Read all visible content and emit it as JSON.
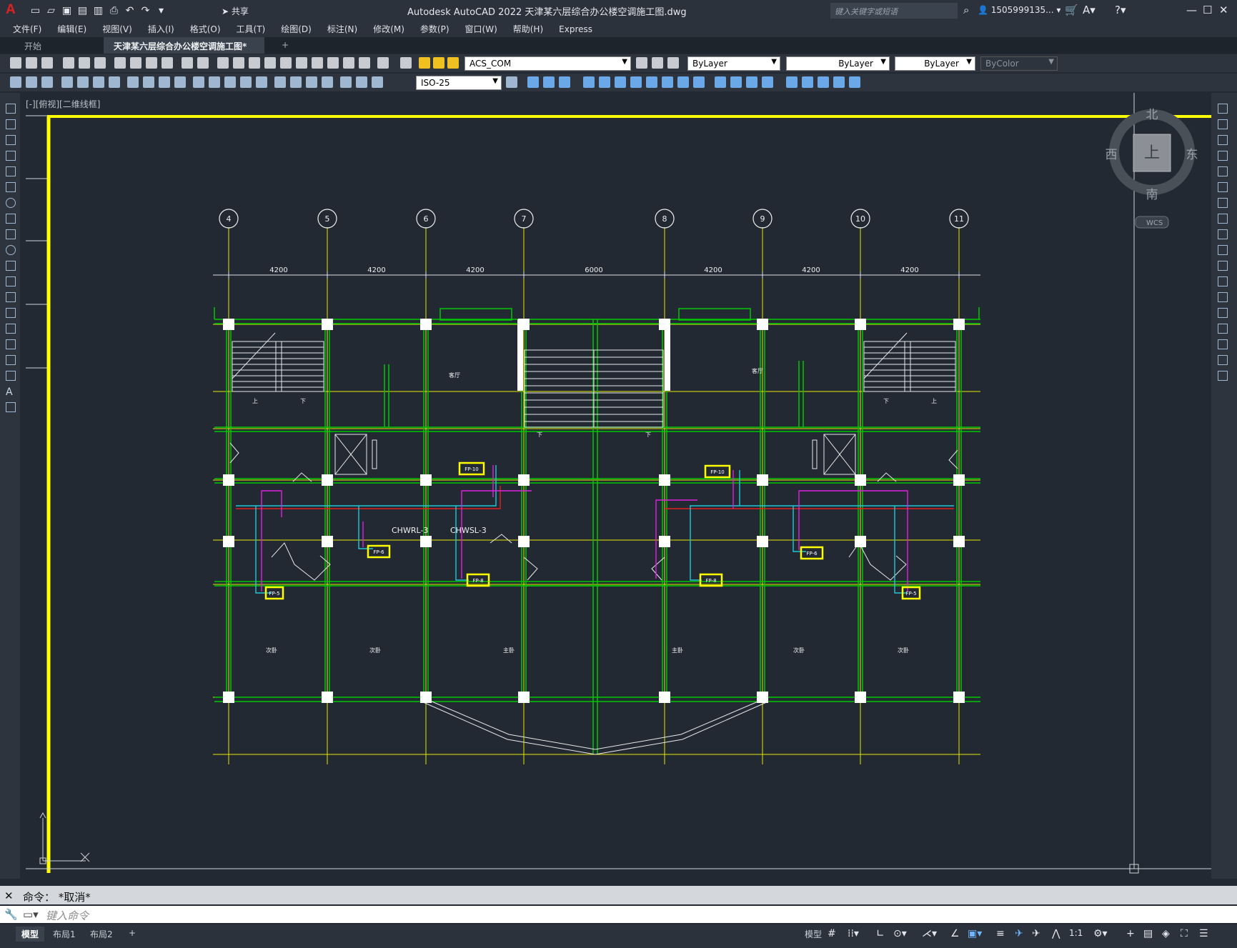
{
  "app": {
    "logo": "A",
    "title": "Autodesk AutoCAD 2022    天津某六层综合办公楼空调施工图.dwg",
    "share_label": "共享",
    "search_placeholder": "键入关键字或短语",
    "user": "1505999135..."
  },
  "menu": [
    "文件(F)",
    "编辑(E)",
    "视图(V)",
    "插入(I)",
    "格式(O)",
    "工具(T)",
    "绘图(D)",
    "标注(N)",
    "修改(M)",
    "参数(P)",
    "窗口(W)",
    "帮助(H)",
    "Express"
  ],
  "tabs": {
    "start": "开始",
    "active": "天津某六层综合办公楼空调施工图*"
  },
  "toolbar": {
    "layer": "ACS_COM",
    "color": "ByLayer",
    "linetype": "ByLayer",
    "lineweight": "ByLayer",
    "plotstyle": "ByColor",
    "dimstyle": "ISO-25"
  },
  "viewport": {
    "label": "[-][俯视][二维线框]",
    "compass": {
      "north": "北",
      "south": "南",
      "east": "东",
      "west": "西",
      "top": "上"
    },
    "wcs": "WCS"
  },
  "drawing": {
    "grid_labels": [
      "4",
      "5",
      "6",
      "7",
      "8",
      "9",
      "10",
      "11"
    ],
    "dims": [
      "4200",
      "4200",
      "4200",
      "6000",
      "4200",
      "4200",
      "4200"
    ],
    "pipes": [
      "CHWRL-3",
      "CHWSL-3"
    ],
    "units": [
      "FP-10",
      "FP-10",
      "FP-6",
      "FP-8",
      "FP-8",
      "FP-6",
      "FP-5",
      "FP-5"
    ],
    "rooms": [
      "客厅",
      "客厅",
      "次卧",
      "次卧",
      "主卧",
      "主卧",
      "次卧",
      "次卧"
    ],
    "stair_marks": [
      "上",
      "下",
      "下",
      "下",
      "下",
      "上"
    ]
  },
  "command": {
    "history": "命令： *取消*",
    "placeholder": "键入命令"
  },
  "status": {
    "model": "模型",
    "layout1": "布局1",
    "layout2": "布局2",
    "scale": "1:1"
  },
  "colors": {
    "bg": "#222933",
    "wall": "#00c800",
    "axis": "#e6e600",
    "border": "#ffff00",
    "supply": "#e02020",
    "return": "#20c8d8",
    "cond": "#e020e0"
  }
}
